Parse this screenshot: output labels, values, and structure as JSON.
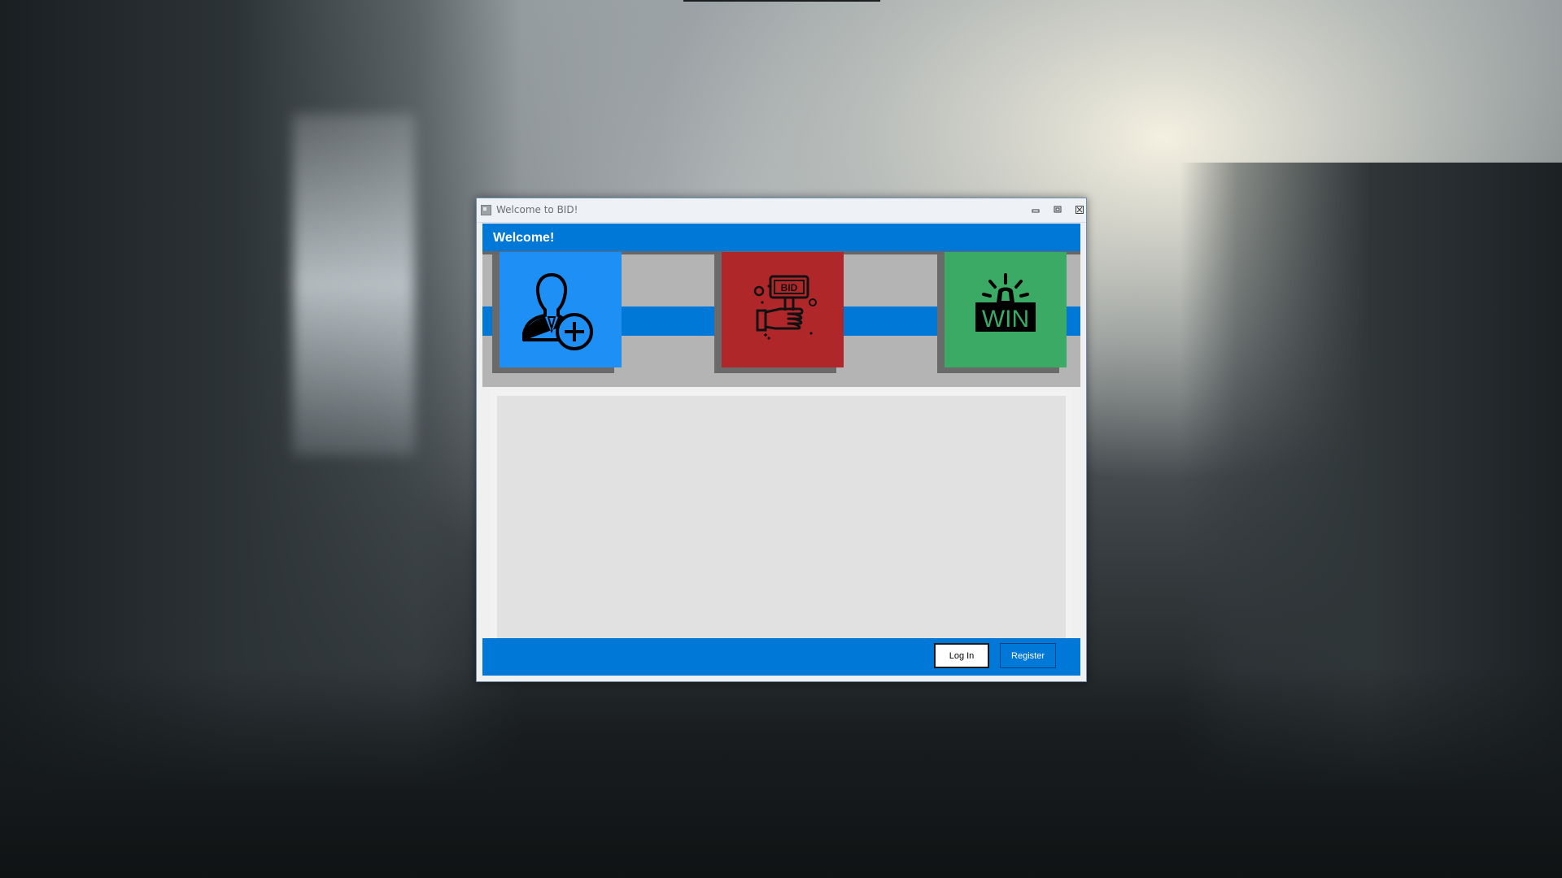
{
  "window": {
    "title": "Welcome to BID!"
  },
  "header": {
    "title": "Welcome!"
  },
  "tiles": [
    {
      "name": "register-user",
      "icon": "user-add-icon",
      "color": "#1e8ff5",
      "label": ""
    },
    {
      "name": "bid",
      "icon": "bid-paddle-icon",
      "color": "#b0272a",
      "label": "BID"
    },
    {
      "name": "win",
      "icon": "win-siren-icon",
      "color": "#3aaa64",
      "label": "WIN"
    }
  ],
  "footer": {
    "login_label": "Log In",
    "register_label": "Register"
  },
  "colors": {
    "accent": "#0078d7",
    "panel": "#b4b4b4",
    "content": "#e1e1e1"
  }
}
